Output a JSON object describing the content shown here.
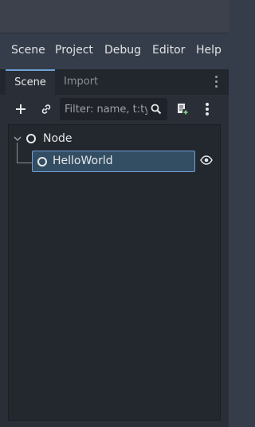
{
  "menu": {
    "items": [
      "Scene",
      "Project",
      "Debug",
      "Editor",
      "Help"
    ]
  },
  "dock": {
    "tabs": [
      {
        "label": "Scene",
        "active": true
      },
      {
        "label": "Import",
        "active": false
      }
    ]
  },
  "toolbar": {
    "add_icon": "plus-icon",
    "link_icon": "link-icon",
    "filter_placeholder": "Filter: name, t:type",
    "search_icon": "search-icon",
    "script_icon": "script-add-icon",
    "more_icon": "kebab-menu-icon"
  },
  "tree": {
    "root": {
      "label": "Node",
      "expanded": true,
      "icon": "node-circle-icon"
    },
    "children": [
      {
        "label": "HelloWorld",
        "selected": true,
        "icon": "node-circle-icon",
        "visibility_icon": "eye-icon"
      }
    ]
  },
  "colors": {
    "accent": "#6fa0d6",
    "selection": "#334d63",
    "panel": "#2a2e36"
  }
}
